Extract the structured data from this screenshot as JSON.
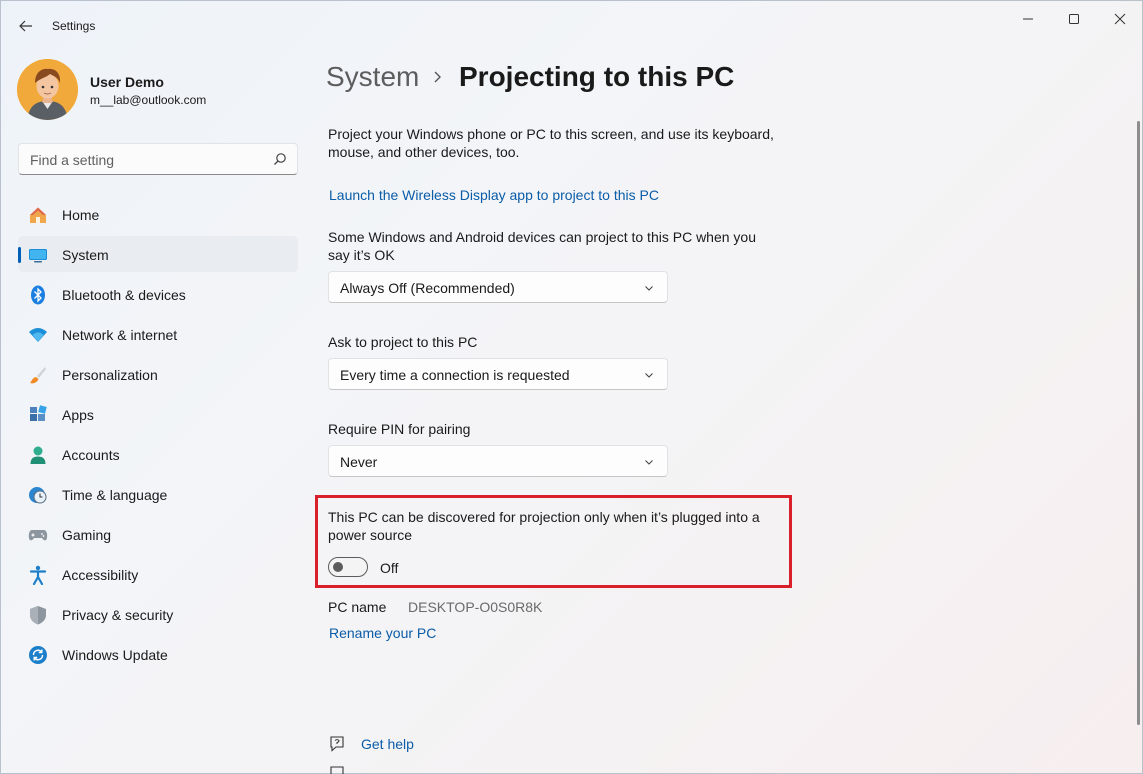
{
  "window": {
    "title": "Settings",
    "controls": [
      "minimize",
      "maximize",
      "close"
    ]
  },
  "profile": {
    "name": "User Demo",
    "email": "m__lab@outlook.com"
  },
  "search": {
    "placeholder": "Find a setting"
  },
  "sidebar": {
    "items": [
      {
        "label": "Home",
        "icon": "home-icon"
      },
      {
        "label": "System",
        "icon": "system-icon",
        "active": true
      },
      {
        "label": "Bluetooth & devices",
        "icon": "bluetooth-icon"
      },
      {
        "label": "Network & internet",
        "icon": "wifi-icon"
      },
      {
        "label": "Personalization",
        "icon": "brush-icon"
      },
      {
        "label": "Apps",
        "icon": "apps-icon"
      },
      {
        "label": "Accounts",
        "icon": "person-icon"
      },
      {
        "label": "Time & language",
        "icon": "clock-globe-icon"
      },
      {
        "label": "Gaming",
        "icon": "gamepad-icon"
      },
      {
        "label": "Accessibility",
        "icon": "accessibility-icon"
      },
      {
        "label": "Privacy & security",
        "icon": "shield-icon"
      },
      {
        "label": "Windows Update",
        "icon": "update-icon"
      }
    ]
  },
  "breadcrumb": {
    "parent": "System",
    "current": "Projecting to this PC"
  },
  "main": {
    "description": "Project your Windows phone or PC to this screen, and use its keyboard, mouse, and other devices, too.",
    "launch_link": "Launch the Wireless Display app to project to this PC",
    "availability": {
      "label": "Some Windows and Android devices can project to this PC when you say it’s OK",
      "value": "Always Off (Recommended)"
    },
    "ask": {
      "label": "Ask to project to this PC",
      "value": "Every time a connection is requested"
    },
    "pin": {
      "label": "Require PIN for pairing",
      "value": "Never"
    },
    "power_toggle": {
      "label": "This PC can be discovered for projection only when it’s plugged into a power source",
      "state": "Off",
      "on": false
    },
    "pc_name": {
      "label": "PC name",
      "value": "DESKTOP-O0S0R8K"
    },
    "rename_link": "Rename your PC",
    "help": {
      "get_help": "Get help"
    }
  },
  "colors": {
    "accent": "#005fb8",
    "link": "#0a5ca8",
    "highlight_border": "#d81f2a"
  }
}
